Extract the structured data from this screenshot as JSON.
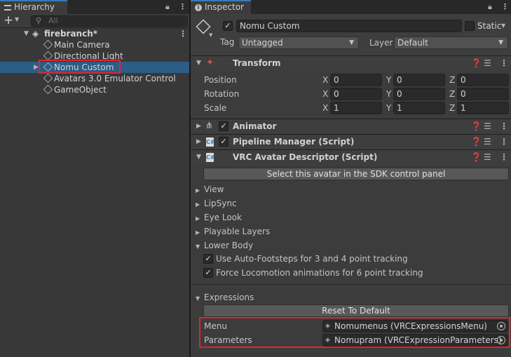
{
  "hierarchy": {
    "tab_label": "Hierarchy",
    "add_label": "+",
    "search_placeholder": "All",
    "scene_name": "firebranch*",
    "items": [
      {
        "label": "Main Camera"
      },
      {
        "label": "Directional Light"
      },
      {
        "label": "Nomu Custom"
      },
      {
        "label": "Avatars 3.0 Emulator Control"
      },
      {
        "label": "GameObject"
      }
    ]
  },
  "inspector": {
    "tab_label": "Inspector",
    "object_name": "Nomu Custom",
    "static_label": "Static",
    "tag_label": "Tag",
    "tag_value": "Untagged",
    "layer_label": "Layer",
    "layer_value": "Default",
    "transform": {
      "title": "Transform",
      "rows": [
        {
          "label": "Position",
          "x": "0",
          "y": "0",
          "z": "0"
        },
        {
          "label": "Rotation",
          "x": "0",
          "y": "0",
          "z": "0"
        },
        {
          "label": "Scale",
          "x": "1",
          "y": "1",
          "z": "1"
        }
      ],
      "axis_x": "X",
      "axis_y": "Y",
      "axis_z": "Z"
    },
    "animator_title": "Animator",
    "pipeline_title": "Pipeline Manager (Script)",
    "vrc": {
      "title": "VRC Avatar Descriptor (Script)",
      "sdk_button": "Select this avatar in the SDK control panel",
      "sections": [
        "View",
        "LipSync",
        "Eye Look",
        "Playable Layers",
        "Lower Body"
      ],
      "auto_footsteps": "Use Auto-Footsteps for 3 and 4 point tracking",
      "force_locomotion": "Force Locomotion animations for 6 point tracking",
      "expressions_label": "Expressions",
      "reset_button": "Reset To Default",
      "menu_label": "Menu",
      "menu_value": "Nomumenus (VRCExpressionsMenu)",
      "parameters_label": "Parameters",
      "parameters_value": "Nomupram (VRCExpressionParameters)"
    }
  },
  "colors": {
    "selection": "#2c5d87",
    "highlight_box": "#e0232f",
    "tab_accent": "#3a79bb"
  }
}
